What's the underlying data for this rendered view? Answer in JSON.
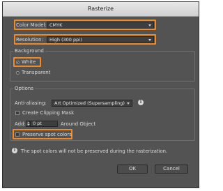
{
  "window": {
    "title": "Rasterize"
  },
  "color_model": {
    "label": "Color Model:",
    "value": "CMYK"
  },
  "resolution": {
    "label": "Resolution:",
    "value": "High (300 ppi)"
  },
  "background": {
    "title": "Background",
    "options": [
      {
        "label": "White",
        "selected": true
      },
      {
        "label": "Transparent",
        "selected": false
      }
    ]
  },
  "options": {
    "title": "Options",
    "anti_aliasing": {
      "label": "Anti-aliasing:",
      "value": "Art Optimized (Supersampling)"
    },
    "clipping_mask": {
      "label": "Create Clipping Mask",
      "checked": false
    },
    "add": {
      "label": "Add:",
      "value": "0 pt",
      "suffix": "Around Object"
    },
    "preserve_spot": {
      "label": "Preserve spot colors",
      "checked": false
    }
  },
  "info_message": "The spot colors will not be preserved during the rasterization.",
  "buttons": {
    "ok": "OK",
    "cancel": "Cancel"
  },
  "colors": {
    "highlight": "#f08a24",
    "panel": "#535353"
  }
}
